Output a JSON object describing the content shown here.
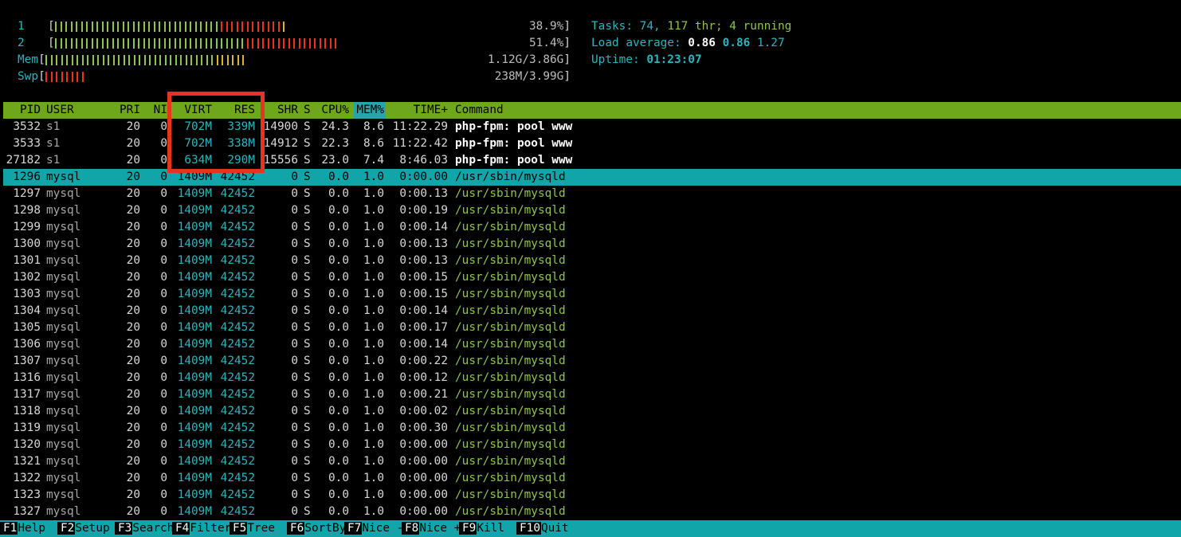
{
  "meters": [
    {
      "label": "1",
      "value": "38.9%",
      "bars": [
        [
          "#8ec44e",
          32
        ],
        [
          "#e8331f",
          12
        ],
        [
          "#d8b52a",
          1
        ]
      ]
    },
    {
      "label": "2",
      "value": "51.4%",
      "bars": [
        [
          "#8ec44e",
          37
        ],
        [
          "#e8331f",
          18
        ]
      ]
    },
    {
      "label": "Mem",
      "value": "1.12G/3.86G",
      "bars": [
        [
          "#8ec44e",
          33
        ],
        [
          "#d8b52a",
          6
        ]
      ]
    },
    {
      "label": "Swp",
      "value": "238M/3.99G",
      "bars": [
        [
          "#e8331f",
          8
        ]
      ]
    }
  ],
  "stats": {
    "tasks_label": "Tasks: ",
    "tasks": "74",
    "sep": ", ",
    "threads": "117",
    "thr_label": " thr; ",
    "running": "4",
    "running_label": " running",
    "load_label": "Load average: ",
    "load1": "0.86",
    "load5": "0.86",
    "load15": "1.27",
    "uptime_label": "Uptime: ",
    "uptime": "01:23:07"
  },
  "columns": [
    "PID",
    "USER",
    "PRI",
    "NI",
    "VIRT",
    "RES",
    "SHR",
    "S",
    "CPU%",
    "MEM%",
    "TIME+",
    "Command"
  ],
  "processes": [
    {
      "pid": "3532",
      "user": "s1",
      "pri": "20",
      "ni": "0",
      "virt": "702M",
      "res": "339M",
      "shr": "14900",
      "s": "S",
      "cpu": "24.3",
      "mem": "8.6",
      "time": "11:22.29",
      "cmd": "php-fpm: pool www"
    },
    {
      "pid": "3533",
      "user": "s1",
      "pri": "20",
      "ni": "0",
      "virt": "702M",
      "res": "338M",
      "shr": "14912",
      "s": "S",
      "cpu": "22.3",
      "mem": "8.6",
      "time": "11:22.42",
      "cmd": "php-fpm: pool www"
    },
    {
      "pid": "27182",
      "user": "s1",
      "pri": "20",
      "ni": "0",
      "virt": "634M",
      "res": "290M",
      "shr": "15556",
      "s": "S",
      "cpu": "23.0",
      "mem": "7.4",
      "time": "8:46.03",
      "cmd": "php-fpm: pool www"
    },
    {
      "pid": "1296",
      "user": "mysql",
      "pri": "20",
      "ni": "0",
      "virt": "1409M",
      "res": "42452",
      "shr": "0",
      "s": "S",
      "cpu": "0.0",
      "mem": "1.0",
      "time": "0:00.00",
      "cmd": "/usr/sbin/mysqld"
    },
    {
      "pid": "1297",
      "user": "mysql",
      "pri": "20",
      "ni": "0",
      "virt": "1409M",
      "res": "42452",
      "shr": "0",
      "s": "S",
      "cpu": "0.0",
      "mem": "1.0",
      "time": "0:00.13",
      "cmd": "/usr/sbin/mysqld"
    },
    {
      "pid": "1298",
      "user": "mysql",
      "pri": "20",
      "ni": "0",
      "virt": "1409M",
      "res": "42452",
      "shr": "0",
      "s": "S",
      "cpu": "0.0",
      "mem": "1.0",
      "time": "0:00.19",
      "cmd": "/usr/sbin/mysqld"
    },
    {
      "pid": "1299",
      "user": "mysql",
      "pri": "20",
      "ni": "0",
      "virt": "1409M",
      "res": "42452",
      "shr": "0",
      "s": "S",
      "cpu": "0.0",
      "mem": "1.0",
      "time": "0:00.14",
      "cmd": "/usr/sbin/mysqld"
    },
    {
      "pid": "1300",
      "user": "mysql",
      "pri": "20",
      "ni": "0",
      "virt": "1409M",
      "res": "42452",
      "shr": "0",
      "s": "S",
      "cpu": "0.0",
      "mem": "1.0",
      "time": "0:00.13",
      "cmd": "/usr/sbin/mysqld"
    },
    {
      "pid": "1301",
      "user": "mysql",
      "pri": "20",
      "ni": "0",
      "virt": "1409M",
      "res": "42452",
      "shr": "0",
      "s": "S",
      "cpu": "0.0",
      "mem": "1.0",
      "time": "0:00.13",
      "cmd": "/usr/sbin/mysqld"
    },
    {
      "pid": "1302",
      "user": "mysql",
      "pri": "20",
      "ni": "0",
      "virt": "1409M",
      "res": "42452",
      "shr": "0",
      "s": "S",
      "cpu": "0.0",
      "mem": "1.0",
      "time": "0:00.15",
      "cmd": "/usr/sbin/mysqld"
    },
    {
      "pid": "1303",
      "user": "mysql",
      "pri": "20",
      "ni": "0",
      "virt": "1409M",
      "res": "42452",
      "shr": "0",
      "s": "S",
      "cpu": "0.0",
      "mem": "1.0",
      "time": "0:00.15",
      "cmd": "/usr/sbin/mysqld"
    },
    {
      "pid": "1304",
      "user": "mysql",
      "pri": "20",
      "ni": "0",
      "virt": "1409M",
      "res": "42452",
      "shr": "0",
      "s": "S",
      "cpu": "0.0",
      "mem": "1.0",
      "time": "0:00.14",
      "cmd": "/usr/sbin/mysqld"
    },
    {
      "pid": "1305",
      "user": "mysql",
      "pri": "20",
      "ni": "0",
      "virt": "1409M",
      "res": "42452",
      "shr": "0",
      "s": "S",
      "cpu": "0.0",
      "mem": "1.0",
      "time": "0:00.17",
      "cmd": "/usr/sbin/mysqld"
    },
    {
      "pid": "1306",
      "user": "mysql",
      "pri": "20",
      "ni": "0",
      "virt": "1409M",
      "res": "42452",
      "shr": "0",
      "s": "S",
      "cpu": "0.0",
      "mem": "1.0",
      "time": "0:00.14",
      "cmd": "/usr/sbin/mysqld"
    },
    {
      "pid": "1307",
      "user": "mysql",
      "pri": "20",
      "ni": "0",
      "virt": "1409M",
      "res": "42452",
      "shr": "0",
      "s": "S",
      "cpu": "0.0",
      "mem": "1.0",
      "time": "0:00.22",
      "cmd": "/usr/sbin/mysqld"
    },
    {
      "pid": "1316",
      "user": "mysql",
      "pri": "20",
      "ni": "0",
      "virt": "1409M",
      "res": "42452",
      "shr": "0",
      "s": "S",
      "cpu": "0.0",
      "mem": "1.0",
      "time": "0:00.12",
      "cmd": "/usr/sbin/mysqld"
    },
    {
      "pid": "1317",
      "user": "mysql",
      "pri": "20",
      "ni": "0",
      "virt": "1409M",
      "res": "42452",
      "shr": "0",
      "s": "S",
      "cpu": "0.0",
      "mem": "1.0",
      "time": "0:00.21",
      "cmd": "/usr/sbin/mysqld"
    },
    {
      "pid": "1318",
      "user": "mysql",
      "pri": "20",
      "ni": "0",
      "virt": "1409M",
      "res": "42452",
      "shr": "0",
      "s": "S",
      "cpu": "0.0",
      "mem": "1.0",
      "time": "0:00.02",
      "cmd": "/usr/sbin/mysqld"
    },
    {
      "pid": "1319",
      "user": "mysql",
      "pri": "20",
      "ni": "0",
      "virt": "1409M",
      "res": "42452",
      "shr": "0",
      "s": "S",
      "cpu": "0.0",
      "mem": "1.0",
      "time": "0:00.30",
      "cmd": "/usr/sbin/mysqld"
    },
    {
      "pid": "1320",
      "user": "mysql",
      "pri": "20",
      "ni": "0",
      "virt": "1409M",
      "res": "42452",
      "shr": "0",
      "s": "S",
      "cpu": "0.0",
      "mem": "1.0",
      "time": "0:00.00",
      "cmd": "/usr/sbin/mysqld"
    },
    {
      "pid": "1321",
      "user": "mysql",
      "pri": "20",
      "ni": "0",
      "virt": "1409M",
      "res": "42452",
      "shr": "0",
      "s": "S",
      "cpu": "0.0",
      "mem": "1.0",
      "time": "0:00.00",
      "cmd": "/usr/sbin/mysqld"
    },
    {
      "pid": "1322",
      "user": "mysql",
      "pri": "20",
      "ni": "0",
      "virt": "1409M",
      "res": "42452",
      "shr": "0",
      "s": "S",
      "cpu": "0.0",
      "mem": "1.0",
      "time": "0:00.00",
      "cmd": "/usr/sbin/mysqld"
    },
    {
      "pid": "1323",
      "user": "mysql",
      "pri": "20",
      "ni": "0",
      "virt": "1409M",
      "res": "42452",
      "shr": "0",
      "s": "S",
      "cpu": "0.0",
      "mem": "1.0",
      "time": "0:00.00",
      "cmd": "/usr/sbin/mysqld"
    },
    {
      "pid": "1327",
      "user": "mysql",
      "pri": "20",
      "ni": "0",
      "virt": "1409M",
      "res": "42452",
      "shr": "0",
      "s": "S",
      "cpu": "0.0",
      "mem": "1.0",
      "time": "0:00.00",
      "cmd": "/usr/sbin/mysqld"
    }
  ],
  "selected_index": 3,
  "footer": [
    {
      "key": "F1",
      "label": "Help"
    },
    {
      "key": "F2",
      "label": "Setup"
    },
    {
      "key": "F3",
      "label": "Search"
    },
    {
      "key": "F4",
      "label": "Filter"
    },
    {
      "key": "F5",
      "label": "Tree"
    },
    {
      "key": "F6",
      "label": "SortBy"
    },
    {
      "key": "F7",
      "label": "Nice -"
    },
    {
      "key": "F8",
      "label": "Nice +"
    },
    {
      "key": "F9",
      "label": "Kill"
    },
    {
      "key": "F10",
      "label": "Quit"
    }
  ],
  "annotation_color": "#e8331f"
}
